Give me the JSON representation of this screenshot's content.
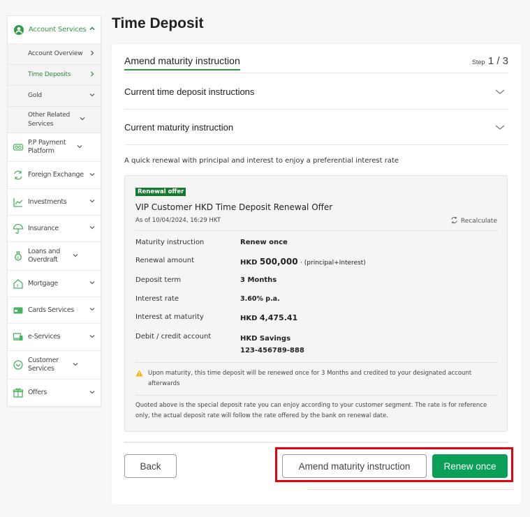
{
  "page": {
    "title": "Time Deposit"
  },
  "sidebar": {
    "head": {
      "label": "Account Services",
      "icon": "user-circle-icon",
      "state": "expanded"
    },
    "subitems": [
      {
        "label": "Account Overview",
        "chevron": "chevron-right",
        "active": false
      },
      {
        "label": "Time Deposits",
        "chevron": "chevron-right",
        "active": true
      },
      {
        "label": "Gold",
        "chevron": "chevron-down",
        "active": false
      },
      {
        "label": "Other Related Services",
        "chevron": "chevron-down",
        "active": false
      }
    ],
    "items": [
      {
        "label": "P.P Payment Platform",
        "icon": "payment-icon"
      },
      {
        "label": "Foreign Exchange",
        "icon": "exchange-icon"
      },
      {
        "label": "Investments",
        "icon": "chart-icon"
      },
      {
        "label": "Insurance",
        "icon": "umbrella-icon"
      },
      {
        "label": "Loans and Overdraft",
        "icon": "money-bag-icon"
      },
      {
        "label": "Mortgage",
        "icon": "house-icon"
      },
      {
        "label": "Cards Services",
        "icon": "card-icon"
      },
      {
        "label": "e-Services",
        "icon": "devices-icon"
      },
      {
        "label": "Customer Services",
        "icon": "support-icon"
      },
      {
        "label": "Offers",
        "icon": "gift-icon"
      }
    ]
  },
  "main": {
    "tab_label": "Amend maturity instruction",
    "step": {
      "prefix": "Step",
      "current": "1 / 3"
    },
    "accordions": [
      {
        "label": "Current time deposit instructions"
      },
      {
        "label": "Current maturity instruction"
      }
    ],
    "intro": "A quick renewal with principal and interest to enjoy a preferential interest rate",
    "offer": {
      "badge": "Renewal offer",
      "title": "VIP Customer HKD Time Deposit Renewal Offer",
      "as_of": "As of 10/04/2024, 16:29 HKT",
      "recalculate_label": "Recalculate",
      "rows": {
        "maturity": {
          "label": "Maturity instruction",
          "value": "Renew once"
        },
        "renewal": {
          "label": "Renewal amount",
          "currency": "HKD",
          "amount": "500,000",
          "suffix": "· (principal+Interest)"
        },
        "term": {
          "label": "Deposit term",
          "value": "3 Months"
        },
        "rate": {
          "label": "Interest rate",
          "value": "3.60% p.a."
        },
        "interest": {
          "label": "Interest at maturity",
          "currency": "HKD",
          "amount": "4,475.41"
        },
        "account": {
          "label": "Debit / credit account",
          "name": "HKD Savings",
          "number": "123-456789-888"
        }
      },
      "warning": "Upon maturity, this time deposit will be renewed once for 3 Months and credited to your designated account afterwards",
      "note": "Quoted above is the special deposit rate you can enjoy according to your customer segment. The rate is for reference only, the actual deposit rate will follow the rate offered by the bank on renewal date."
    },
    "buttons": {
      "back": "Back",
      "amend": "Amend maturity instruction",
      "renew": "Renew once"
    }
  },
  "colors": {
    "brand_green": "#2e9c48",
    "primary_button": "#0b9f58",
    "badge": "#137a2e",
    "highlight_box": "#e8000b"
  }
}
